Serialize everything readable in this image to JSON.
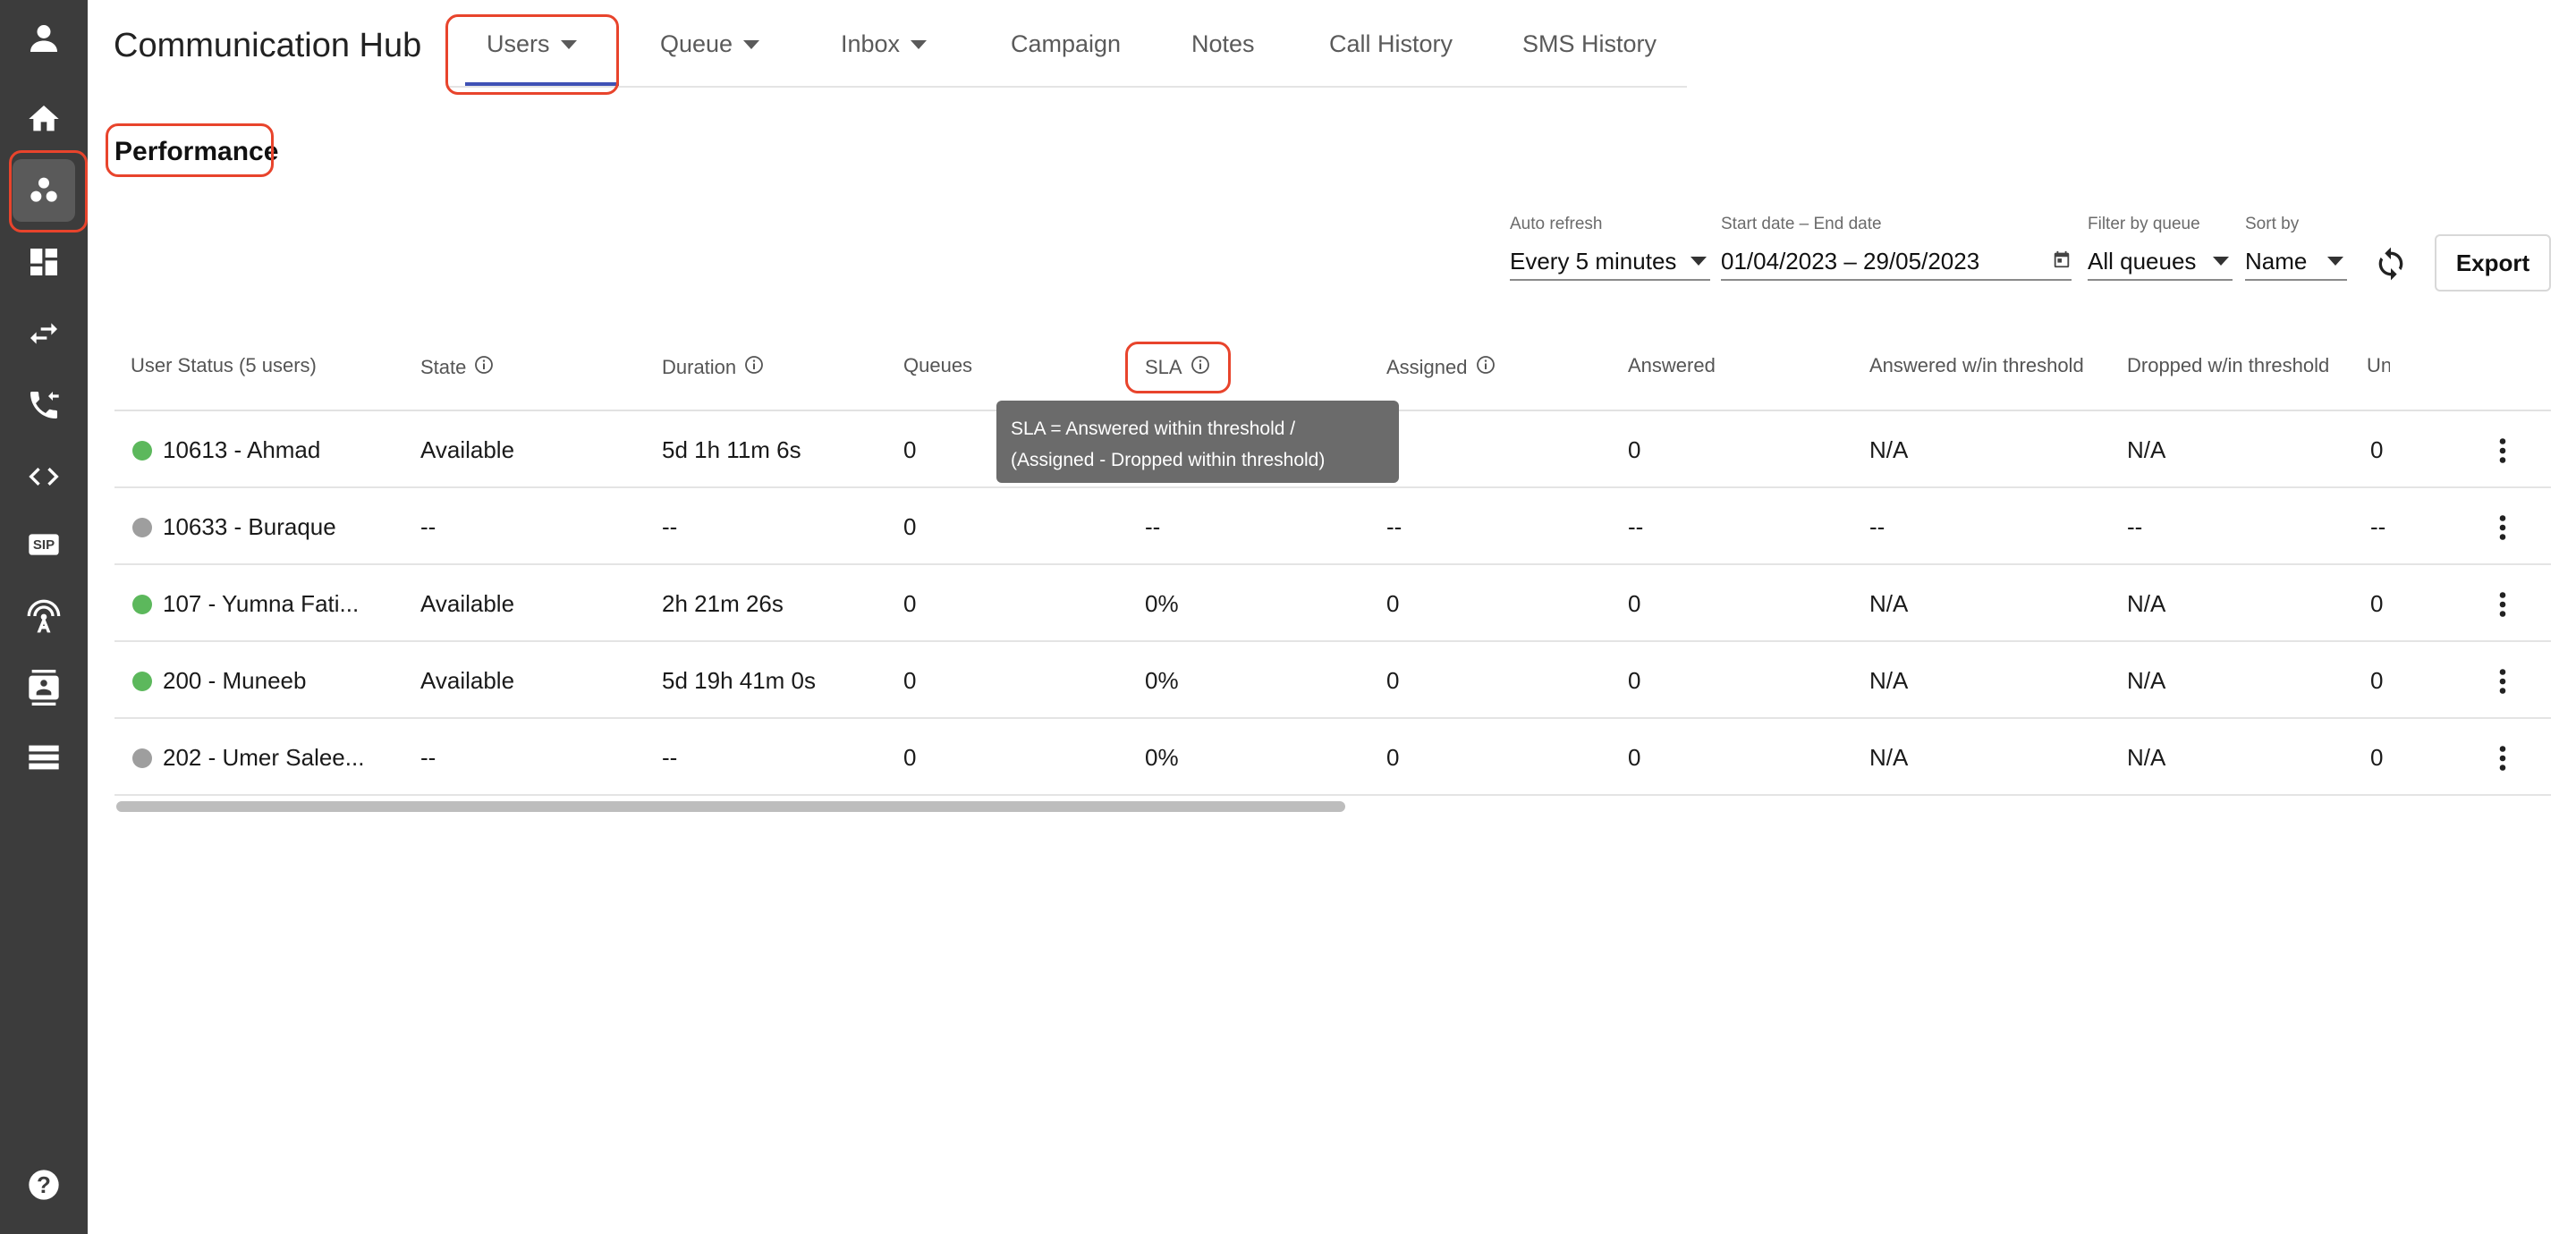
{
  "app": {
    "title": "Communication Hub"
  },
  "nav": {
    "tabs": [
      {
        "label": "Users",
        "dropdown": true,
        "active": true
      },
      {
        "label": "Queue",
        "dropdown": true
      },
      {
        "label": "Inbox",
        "dropdown": true
      },
      {
        "label": "Campaign"
      },
      {
        "label": "Notes"
      },
      {
        "label": "Call History"
      },
      {
        "label": "SMS History"
      }
    ]
  },
  "rail": {
    "icons": [
      "person-icon",
      "home-icon",
      "users-group-icon",
      "dashboard-icon",
      "swap-arrows-icon",
      "phone-forward-icon",
      "code-icon",
      "sip-icon",
      "antenna-icon",
      "contact-card-icon",
      "list-icon",
      "help-icon"
    ],
    "sip_text": "SIP",
    "help_text": "?"
  },
  "page": {
    "title": "Performance"
  },
  "filters": {
    "auto_refresh": {
      "label": "Auto refresh",
      "value": "Every 5 minutes"
    },
    "date_range": {
      "label": "Start date – End date",
      "value": "01/04/2023 – 29/05/2023"
    },
    "queue": {
      "label": "Filter by queue",
      "value": "All queues"
    },
    "sort": {
      "label": "Sort by",
      "value": "Name"
    },
    "export_label": "Export"
  },
  "table": {
    "columns": [
      {
        "label": "User Status (5 users)",
        "info": false
      },
      {
        "label": "State",
        "info": true
      },
      {
        "label": "Duration",
        "info": true
      },
      {
        "label": "Queues",
        "info": false
      },
      {
        "label": "SLA",
        "info": true
      },
      {
        "label": "Assigned",
        "info": true
      },
      {
        "label": "Answered",
        "info": false
      },
      {
        "label": "Answered w/in threshold",
        "info": false
      },
      {
        "label": "Dropped w/in threshold",
        "info": false
      },
      {
        "label": "Un",
        "info": false
      }
    ],
    "rows": [
      {
        "status": "online",
        "user": "10613 - Ahmad",
        "state": "Available",
        "duration": "5d 1h 11m 6s",
        "queues": "0",
        "sla": "",
        "assigned": "0",
        "answered": "0",
        "answered_threshold": "N/A",
        "dropped_threshold": "N/A",
        "un": "0"
      },
      {
        "status": "offline",
        "user": "10633 - Buraque",
        "state": "--",
        "duration": "--",
        "queues": "0",
        "sla": "--",
        "assigned": "--",
        "answered": "--",
        "answered_threshold": "--",
        "dropped_threshold": "--",
        "un": "--"
      },
      {
        "status": "online",
        "user": "107 - Yumna Fati...",
        "state": "Available",
        "duration": "2h 21m 26s",
        "queues": "0",
        "sla": "0%",
        "assigned": "0",
        "answered": "0",
        "answered_threshold": "N/A",
        "dropped_threshold": "N/A",
        "un": "0"
      },
      {
        "status": "online",
        "user": "200 - Muneeb",
        "state": "Available",
        "duration": "5d 19h 41m 0s",
        "queues": "0",
        "sla": "0%",
        "assigned": "0",
        "answered": "0",
        "answered_threshold": "N/A",
        "dropped_threshold": "N/A",
        "un": "0"
      },
      {
        "status": "offline",
        "user": "202 - Umer Salee...",
        "state": "--",
        "duration": "--",
        "queues": "0",
        "sla": "0%",
        "assigned": "0",
        "answered": "0",
        "answered_threshold": "N/A",
        "dropped_threshold": "N/A",
        "un": "0"
      }
    ]
  },
  "tooltip": {
    "line1": "SLA = Answered within threshold /",
    "line2": "(Assigned - Dropped within threshold)"
  },
  "colors": {
    "rail_bg": "#3c3c3c",
    "status_online": "#5cb85c",
    "status_offline": "#9e9e9e",
    "tab_underline": "#3f51b5",
    "annotation": "#e8442c",
    "tooltip_bg": "#6b6b6b"
  }
}
